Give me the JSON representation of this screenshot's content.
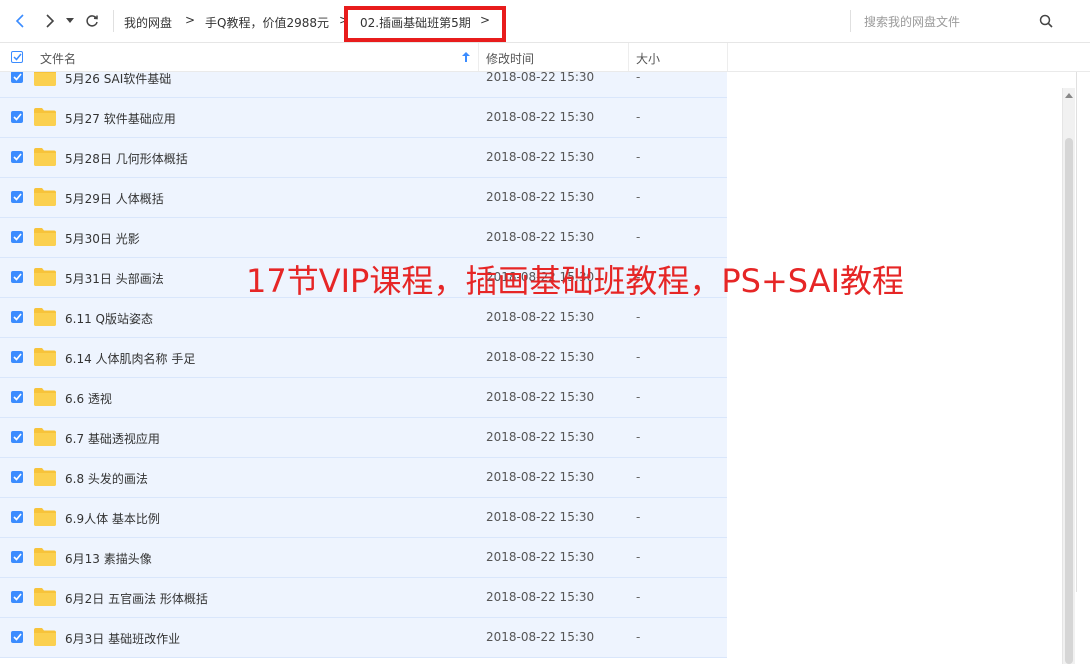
{
  "toolbar": {
    "breadcrumbs": [
      "我的网盘",
      "手Q教程，价值2988元",
      "02.插画基础班第5期"
    ],
    "arrow": ">",
    "search_placeholder": "搜索我的网盘文件"
  },
  "columns": {
    "name": "文件名",
    "modified": "修改时间",
    "size": "大小"
  },
  "files": [
    {
      "name": "5月26 SAI软件基础",
      "modified": "2018-08-22 15:30",
      "size": "-"
    },
    {
      "name": "5月27 软件基础应用",
      "modified": "2018-08-22 15:30",
      "size": "-"
    },
    {
      "name": "5月28日 几何形体概括",
      "modified": "2018-08-22 15:30",
      "size": "-"
    },
    {
      "name": "5月29日 人体概括",
      "modified": "2018-08-22 15:30",
      "size": "-"
    },
    {
      "name": "5月30日 光影",
      "modified": "2018-08-22 15:30",
      "size": "-"
    },
    {
      "name": "5月31日 头部画法",
      "modified": "2018-08-22 15:30",
      "size": "-"
    },
    {
      "name": "6.11 Q版站姿态",
      "modified": "2018-08-22 15:30",
      "size": "-"
    },
    {
      "name": "6.14 人体肌肉名称 手足",
      "modified": "2018-08-22 15:30",
      "size": "-"
    },
    {
      "name": "6.6 透视",
      "modified": "2018-08-22 15:30",
      "size": "-"
    },
    {
      "name": "6.7 基础透视应用",
      "modified": "2018-08-22 15:30",
      "size": "-"
    },
    {
      "name": "6.8 头发的画法",
      "modified": "2018-08-22 15:30",
      "size": "-"
    },
    {
      "name": "6.9人体 基本比例",
      "modified": "2018-08-22 15:30",
      "size": "-"
    },
    {
      "name": "6月13 素描头像",
      "modified": "2018-08-22 15:30",
      "size": "-"
    },
    {
      "name": "6月2日 五官画法 形体概括",
      "modified": "2018-08-22 15:30",
      "size": "-"
    },
    {
      "name": "6月3日 基础班改作业",
      "modified": "2018-08-22 15:30",
      "size": "-"
    }
  ],
  "overlay": "17节VIP课程，插画基础班教程，PS+SAI教程",
  "colors": {
    "accent": "#3b8cff",
    "folder": "#f7c33a",
    "highlight": "#e81c1c",
    "row_selected": "#eef4fe"
  },
  "icons": [
    "back-arrow-icon",
    "forward-arrow-icon",
    "dropdown-icon",
    "refresh-icon",
    "search-icon",
    "folder-icon",
    "sort-up-icon",
    "check-icon"
  ]
}
